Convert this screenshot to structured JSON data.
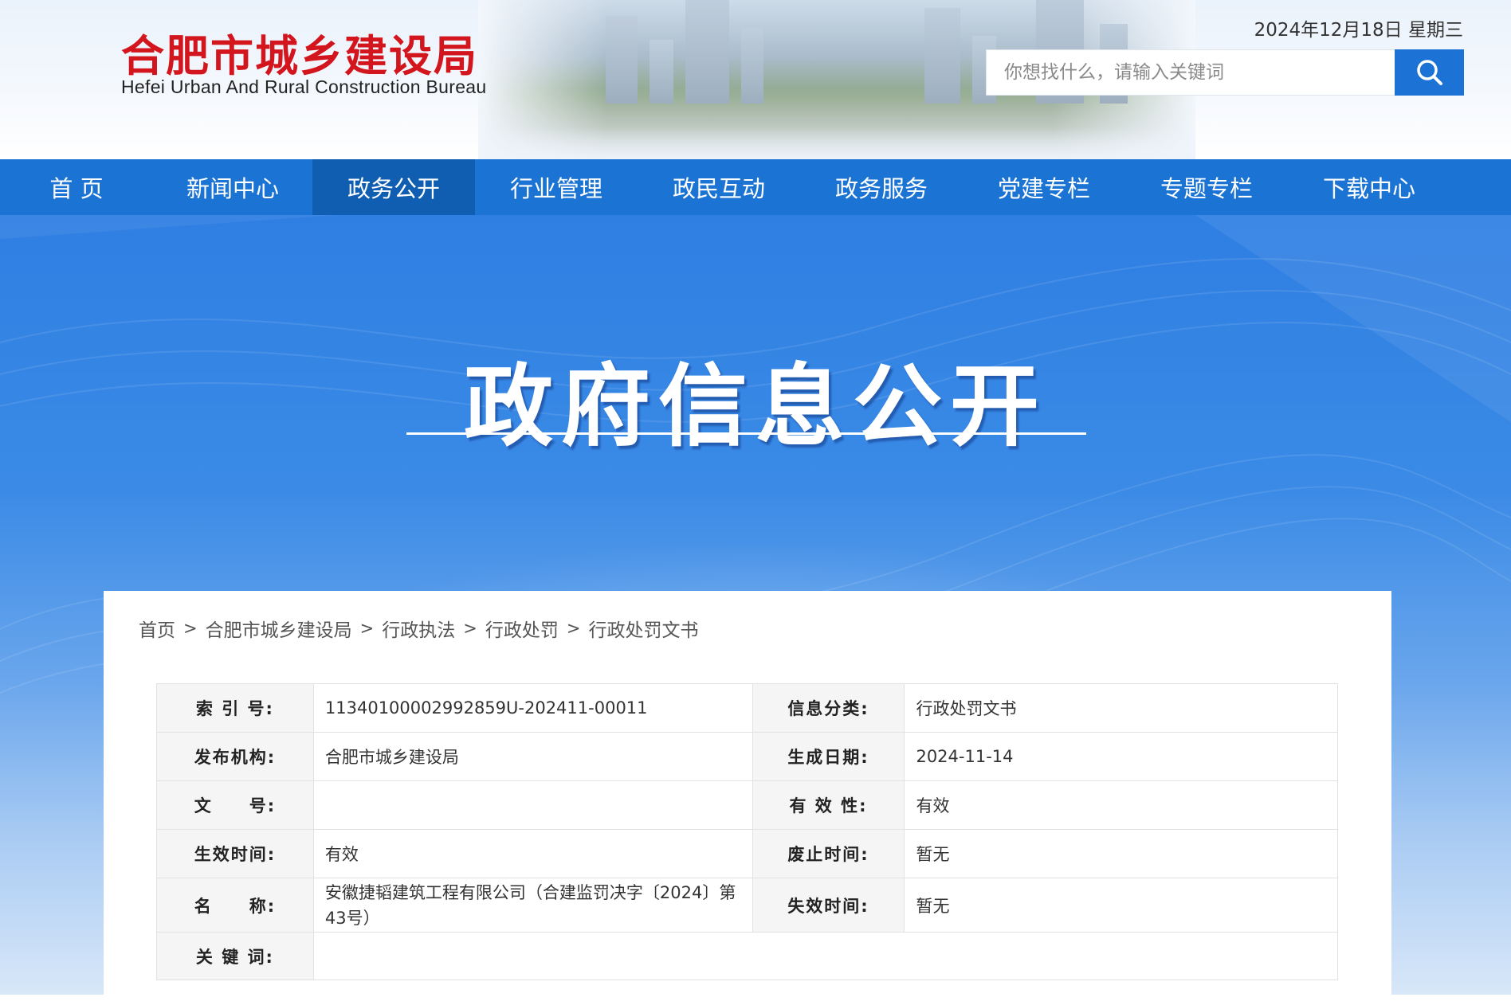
{
  "header": {
    "logo_cn": "合肥市城乡建设局",
    "logo_en": "Hefei Urban And Rural Construction Bureau",
    "date": "2024年12月18日 星期三",
    "search_placeholder": "你想找什么，请输入关键词",
    "search_icon": "search-icon"
  },
  "nav": {
    "items": [
      {
        "label": "首  页"
      },
      {
        "label": "新闻中心"
      },
      {
        "label": "政务公开",
        "active": true
      },
      {
        "label": "行业管理"
      },
      {
        "label": "政民互动"
      },
      {
        "label": "政务服务"
      },
      {
        "label": "党建专栏"
      },
      {
        "label": "专题专栏"
      },
      {
        "label": "下载中心"
      }
    ]
  },
  "banner": {
    "title": "政府信息公开"
  },
  "breadcrumb": {
    "items": [
      "首页",
      "合肥市城乡建设局",
      "行政执法",
      "行政处罚",
      "行政处罚文书"
    ],
    "separator": ">"
  },
  "meta": {
    "rows": [
      {
        "l1": "索 引 号:",
        "v1": "11340100002992859U-202411-00011",
        "l2": "信息分类:",
        "v2": "行政处罚文书"
      },
      {
        "l1": "发布机构:",
        "v1": "合肥市城乡建设局",
        "l2": "生成日期:",
        "v2": "2024-11-14"
      },
      {
        "l1": "文　　号:",
        "v1": "",
        "l2": "有 效 性:",
        "v2": "有效"
      },
      {
        "l1": "生效时间:",
        "v1": "有效",
        "l2": "废止时间:",
        "v2": "暂无"
      },
      {
        "l1": "名　　称:",
        "v1": "安徽捷韬建筑工程有限公司（合建监罚决字〔2024〕第43号）",
        "l2": "失效时间:",
        "v2": "暂无"
      }
    ],
    "keyword_label": "关 键 词:",
    "keyword_value": ""
  },
  "colors": {
    "brand_red": "#d3151d",
    "nav_blue": "#1b74d3",
    "nav_active": "#0f5eb2",
    "search_button": "#1c73d5"
  }
}
